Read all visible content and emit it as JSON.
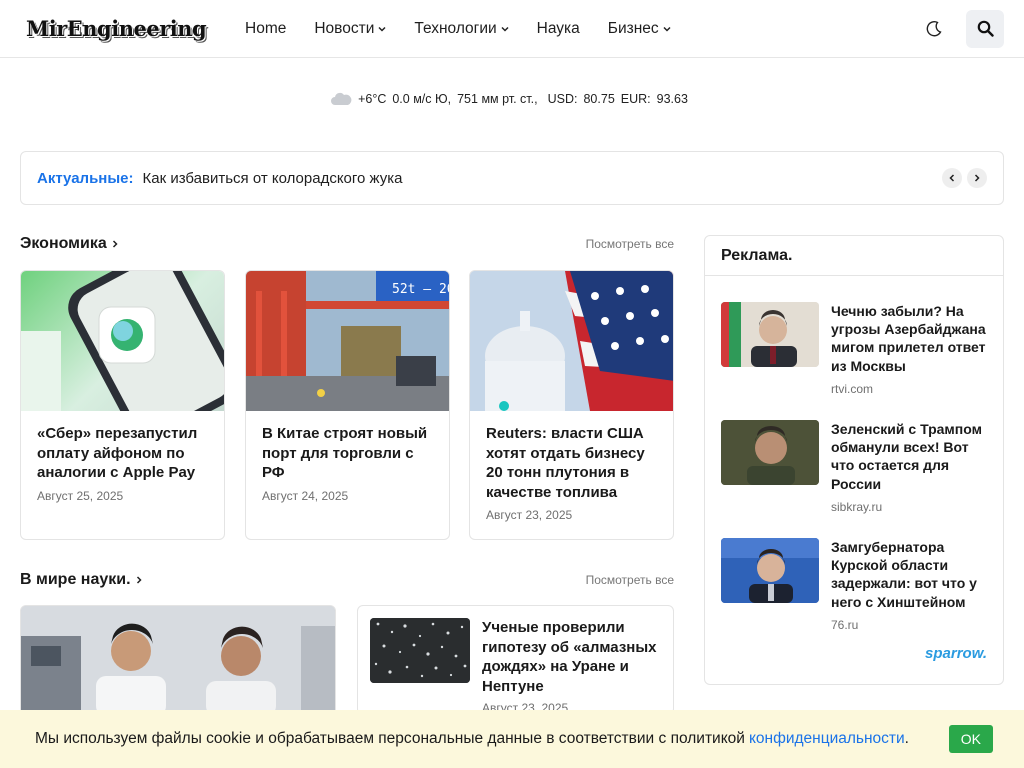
{
  "header": {
    "logo": "MirEngineering",
    "nav": [
      {
        "label": "Home",
        "has_dropdown": false
      },
      {
        "label": "Новости",
        "has_dropdown": true
      },
      {
        "label": "Технологии",
        "has_dropdown": true
      },
      {
        "label": "Наука",
        "has_dropdown": false
      },
      {
        "label": "Бизнес",
        "has_dropdown": true
      }
    ],
    "icons": {
      "theme": "moon-icon",
      "search": "search-icon"
    }
  },
  "info": {
    "temp": "+6°C",
    "wind": "0.0 м/с Ю,",
    "pressure": "751 мм рт. ст.,",
    "usd_label": "USD:",
    "usd": "80.75",
    "eur_label": "EUR:",
    "eur": "93.63"
  },
  "trending": {
    "label": "Актуальные:",
    "title": "Как избавиться от колорадского жука"
  },
  "economy": {
    "title": "Экономика",
    "see_all": "Посмотреть все",
    "cards": [
      {
        "title": "«Сбер» перезапустил оплату айфоном по аналогии с Apple Pay",
        "date": "Август 25, 2025"
      },
      {
        "title": "В Китае строят новый порт для торговли с РФ",
        "date": "Август 24, 2025"
      },
      {
        "title": "Reuters: власти США хотят отдать бизнесу 20 тонн плутония в качестве топлива",
        "date": "Август 23, 2025"
      }
    ]
  },
  "science": {
    "title": "В мире науки.",
    "see_all": "Посмотреть все",
    "item": {
      "title": "Ученые проверили гипотезу об «алмазных дождях» на Уране и Нептуне",
      "date": "Август 23, 2025"
    }
  },
  "sidebar": {
    "title": "Реклама.",
    "ads": [
      {
        "title": "Чечню забыли? На угрозы Азербайджана мигом прилетел ответ из Москвы",
        "source": "rtvi.com"
      },
      {
        "title": "Зеленский с Трампом обманули всех! Вот что остается для России",
        "source": "sibkray.ru"
      },
      {
        "title": "Замгубернатора Курской области задержали: вот что у него с Хинштейном",
        "source": "76.ru"
      }
    ],
    "brand": "sparrow."
  },
  "cookie": {
    "text": "Мы используем файлы cookie и обрабатываем персональные данные в соответствии с политикой",
    "link": "конфиденциальности",
    "dot": ".",
    "ok": "OK"
  },
  "colors": {
    "accent": "#1a73e8",
    "ok_button": "#2aa84a",
    "cookie_bg": "#fcf8dc"
  }
}
